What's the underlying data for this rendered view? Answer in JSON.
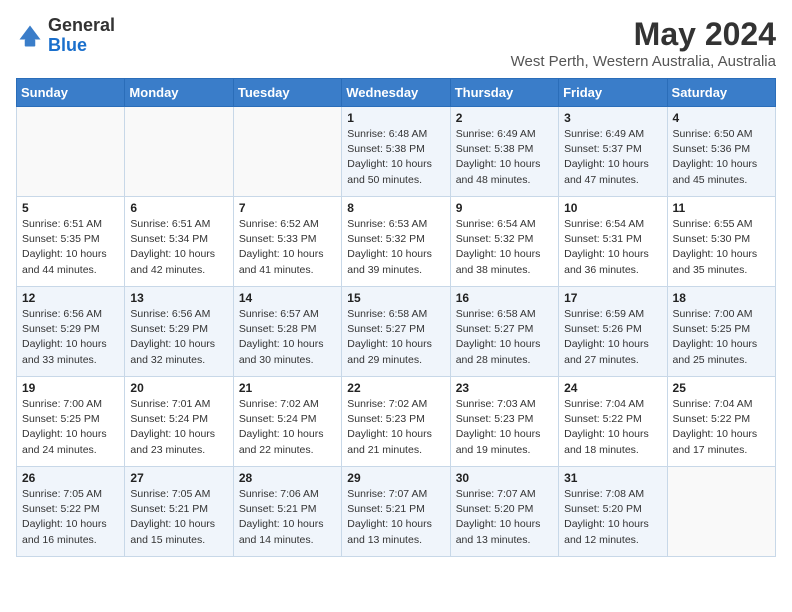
{
  "logo": {
    "general": "General",
    "blue": "Blue"
  },
  "title": "May 2024",
  "subtitle": "West Perth, Western Australia, Australia",
  "days_header": [
    "Sunday",
    "Monday",
    "Tuesday",
    "Wednesday",
    "Thursday",
    "Friday",
    "Saturday"
  ],
  "weeks": [
    [
      {
        "day": "",
        "info": ""
      },
      {
        "day": "",
        "info": ""
      },
      {
        "day": "",
        "info": ""
      },
      {
        "day": "1",
        "info": "Sunrise: 6:48 AM\nSunset: 5:38 PM\nDaylight: 10 hours\nand 50 minutes."
      },
      {
        "day": "2",
        "info": "Sunrise: 6:49 AM\nSunset: 5:38 PM\nDaylight: 10 hours\nand 48 minutes."
      },
      {
        "day": "3",
        "info": "Sunrise: 6:49 AM\nSunset: 5:37 PM\nDaylight: 10 hours\nand 47 minutes."
      },
      {
        "day": "4",
        "info": "Sunrise: 6:50 AM\nSunset: 5:36 PM\nDaylight: 10 hours\nand 45 minutes."
      }
    ],
    [
      {
        "day": "5",
        "info": "Sunrise: 6:51 AM\nSunset: 5:35 PM\nDaylight: 10 hours\nand 44 minutes."
      },
      {
        "day": "6",
        "info": "Sunrise: 6:51 AM\nSunset: 5:34 PM\nDaylight: 10 hours\nand 42 minutes."
      },
      {
        "day": "7",
        "info": "Sunrise: 6:52 AM\nSunset: 5:33 PM\nDaylight: 10 hours\nand 41 minutes."
      },
      {
        "day": "8",
        "info": "Sunrise: 6:53 AM\nSunset: 5:32 PM\nDaylight: 10 hours\nand 39 minutes."
      },
      {
        "day": "9",
        "info": "Sunrise: 6:54 AM\nSunset: 5:32 PM\nDaylight: 10 hours\nand 38 minutes."
      },
      {
        "day": "10",
        "info": "Sunrise: 6:54 AM\nSunset: 5:31 PM\nDaylight: 10 hours\nand 36 minutes."
      },
      {
        "day": "11",
        "info": "Sunrise: 6:55 AM\nSunset: 5:30 PM\nDaylight: 10 hours\nand 35 minutes."
      }
    ],
    [
      {
        "day": "12",
        "info": "Sunrise: 6:56 AM\nSunset: 5:29 PM\nDaylight: 10 hours\nand 33 minutes."
      },
      {
        "day": "13",
        "info": "Sunrise: 6:56 AM\nSunset: 5:29 PM\nDaylight: 10 hours\nand 32 minutes."
      },
      {
        "day": "14",
        "info": "Sunrise: 6:57 AM\nSunset: 5:28 PM\nDaylight: 10 hours\nand 30 minutes."
      },
      {
        "day": "15",
        "info": "Sunrise: 6:58 AM\nSunset: 5:27 PM\nDaylight: 10 hours\nand 29 minutes."
      },
      {
        "day": "16",
        "info": "Sunrise: 6:58 AM\nSunset: 5:27 PM\nDaylight: 10 hours\nand 28 minutes."
      },
      {
        "day": "17",
        "info": "Sunrise: 6:59 AM\nSunset: 5:26 PM\nDaylight: 10 hours\nand 27 minutes."
      },
      {
        "day": "18",
        "info": "Sunrise: 7:00 AM\nSunset: 5:25 PM\nDaylight: 10 hours\nand 25 minutes."
      }
    ],
    [
      {
        "day": "19",
        "info": "Sunrise: 7:00 AM\nSunset: 5:25 PM\nDaylight: 10 hours\nand 24 minutes."
      },
      {
        "day": "20",
        "info": "Sunrise: 7:01 AM\nSunset: 5:24 PM\nDaylight: 10 hours\nand 23 minutes."
      },
      {
        "day": "21",
        "info": "Sunrise: 7:02 AM\nSunset: 5:24 PM\nDaylight: 10 hours\nand 22 minutes."
      },
      {
        "day": "22",
        "info": "Sunrise: 7:02 AM\nSunset: 5:23 PM\nDaylight: 10 hours\nand 21 minutes."
      },
      {
        "day": "23",
        "info": "Sunrise: 7:03 AM\nSunset: 5:23 PM\nDaylight: 10 hours\nand 19 minutes."
      },
      {
        "day": "24",
        "info": "Sunrise: 7:04 AM\nSunset: 5:22 PM\nDaylight: 10 hours\nand 18 minutes."
      },
      {
        "day": "25",
        "info": "Sunrise: 7:04 AM\nSunset: 5:22 PM\nDaylight: 10 hours\nand 17 minutes."
      }
    ],
    [
      {
        "day": "26",
        "info": "Sunrise: 7:05 AM\nSunset: 5:22 PM\nDaylight: 10 hours\nand 16 minutes."
      },
      {
        "day": "27",
        "info": "Sunrise: 7:05 AM\nSunset: 5:21 PM\nDaylight: 10 hours\nand 15 minutes."
      },
      {
        "day": "28",
        "info": "Sunrise: 7:06 AM\nSunset: 5:21 PM\nDaylight: 10 hours\nand 14 minutes."
      },
      {
        "day": "29",
        "info": "Sunrise: 7:07 AM\nSunset: 5:21 PM\nDaylight: 10 hours\nand 13 minutes."
      },
      {
        "day": "30",
        "info": "Sunrise: 7:07 AM\nSunset: 5:20 PM\nDaylight: 10 hours\nand 13 minutes."
      },
      {
        "day": "31",
        "info": "Sunrise: 7:08 AM\nSunset: 5:20 PM\nDaylight: 10 hours\nand 12 minutes."
      },
      {
        "day": "",
        "info": ""
      }
    ]
  ]
}
